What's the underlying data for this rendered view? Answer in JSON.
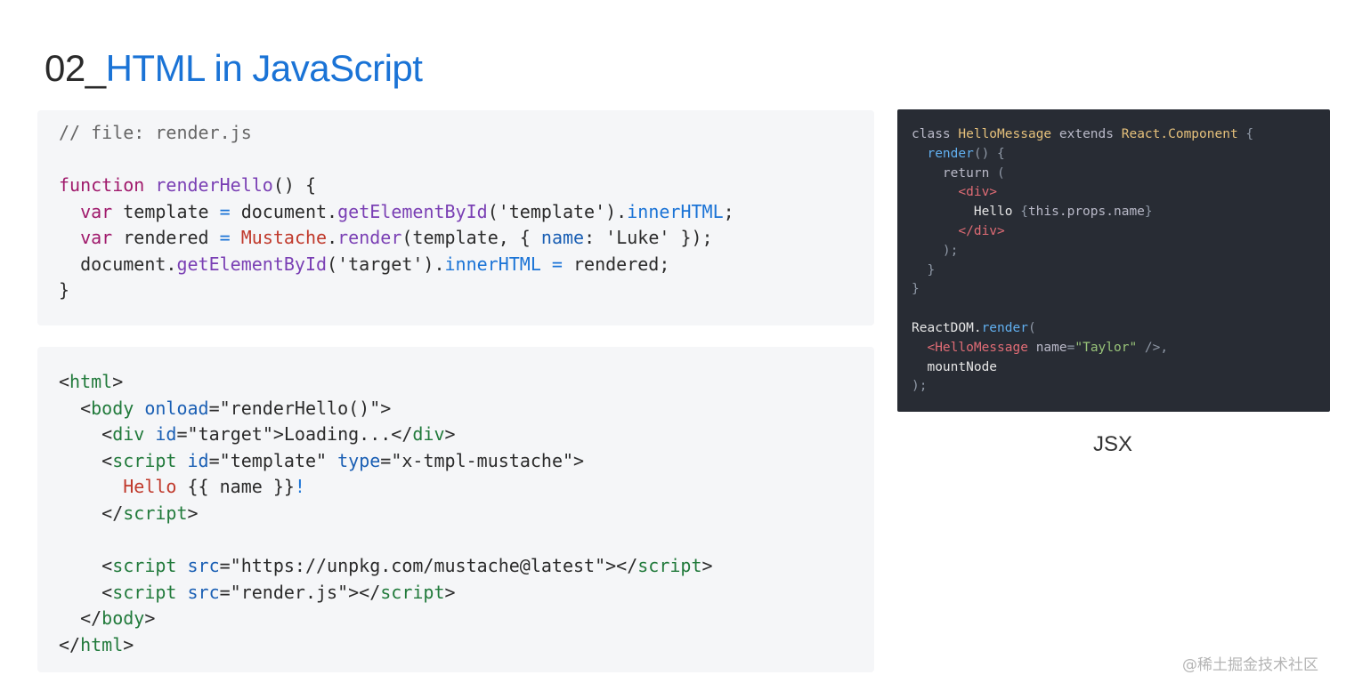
{
  "title": {
    "number": "02_",
    "text": "HTML in JavaScript"
  },
  "colors": {
    "title_accent": "#1a73d6",
    "code_keyword": "#a01a6c",
    "code_function": "#7a3fb4",
    "code_var": "#a01a6c",
    "code_method": "#1a73d6",
    "code_class": "#c0392b",
    "code_string": "#2b2b2b",
    "code_prop": "#1a5fb4",
    "code_comment": "#666666",
    "code_tag": "#217a3b",
    "code_attr": "#1a5fb4",
    "dark_bg": "#282c34",
    "dark_default": "#e6e6e6",
    "dark_keyword": "#b9b9c8",
    "dark_class": "#e5c07b",
    "dark_func": "#61afef",
    "dark_tag": "#e06c75",
    "dark_string": "#98c379",
    "dark_punct": "#8f98a6",
    "dark_attr": "#b9b9c8"
  },
  "code_js": [
    [
      {
        "t": "// file: render.js",
        "c": "code_comment"
      }
    ],
    [],
    [
      {
        "t": "function",
        "c": "code_keyword"
      },
      {
        "t": " "
      },
      {
        "t": "renderHello",
        "c": "code_function"
      },
      {
        "t": "() {"
      }
    ],
    [
      {
        "t": "  "
      },
      {
        "t": "var",
        "c": "code_var"
      },
      {
        "t": " template "
      },
      {
        "t": "=",
        "c": "code_method"
      },
      {
        "t": " document."
      },
      {
        "t": "getElementById",
        "c": "code_function"
      },
      {
        "t": "('template')."
      },
      {
        "t": "innerHTML",
        "c": "code_method"
      },
      {
        "t": ";"
      }
    ],
    [
      {
        "t": "  "
      },
      {
        "t": "var",
        "c": "code_var"
      },
      {
        "t": " rendered "
      },
      {
        "t": "=",
        "c": "code_method"
      },
      {
        "t": " "
      },
      {
        "t": "Mustache",
        "c": "code_class"
      },
      {
        "t": "."
      },
      {
        "t": "render",
        "c": "code_function"
      },
      {
        "t": "(template, { "
      },
      {
        "t": "name",
        "c": "code_prop"
      },
      {
        "t": ": 'Luke' });"
      }
    ],
    [
      {
        "t": "  document."
      },
      {
        "t": "getElementById",
        "c": "code_function"
      },
      {
        "t": "('target')."
      },
      {
        "t": "innerHTML",
        "c": "code_method"
      },
      {
        "t": " "
      },
      {
        "t": "=",
        "c": "code_method"
      },
      {
        "t": " rendered;"
      }
    ],
    [
      {
        "t": "}"
      }
    ]
  ],
  "code_html": [
    [
      {
        "t": "<"
      },
      {
        "t": "html",
        "c": "code_tag"
      },
      {
        "t": ">"
      }
    ],
    [
      {
        "t": "  <"
      },
      {
        "t": "body",
        "c": "code_tag"
      },
      {
        "t": " "
      },
      {
        "t": "onload",
        "c": "code_attr"
      },
      {
        "t": "=\"renderHello()\">"
      }
    ],
    [
      {
        "t": "    <"
      },
      {
        "t": "div",
        "c": "code_tag"
      },
      {
        "t": " "
      },
      {
        "t": "id",
        "c": "code_attr"
      },
      {
        "t": "=\"target\">Loading...</"
      },
      {
        "t": "div",
        "c": "code_tag"
      },
      {
        "t": ">"
      }
    ],
    [
      {
        "t": "    <"
      },
      {
        "t": "script",
        "c": "code_tag"
      },
      {
        "t": " "
      },
      {
        "t": "id",
        "c": "code_attr"
      },
      {
        "t": "=\"template\" "
      },
      {
        "t": "type",
        "c": "code_attr"
      },
      {
        "t": "=\"x-tmpl-mustache\">"
      }
    ],
    [
      {
        "t": "      "
      },
      {
        "t": "Hello",
        "c": "code_class"
      },
      {
        "t": " {{ name }}"
      },
      {
        "t": "!",
        "c": "code_method"
      }
    ],
    [
      {
        "t": "    </"
      },
      {
        "t": "script",
        "c": "code_tag"
      },
      {
        "t": ">"
      }
    ],
    [],
    [
      {
        "t": "    <"
      },
      {
        "t": "script",
        "c": "code_tag"
      },
      {
        "t": " "
      },
      {
        "t": "src",
        "c": "code_attr"
      },
      {
        "t": "=\"https://unpkg.com/mustache@latest\"></"
      },
      {
        "t": "script",
        "c": "code_tag"
      },
      {
        "t": ">"
      }
    ],
    [
      {
        "t": "    <"
      },
      {
        "t": "script",
        "c": "code_tag"
      },
      {
        "t": " "
      },
      {
        "t": "src",
        "c": "code_attr"
      },
      {
        "t": "=\"render.js\"></"
      },
      {
        "t": "script",
        "c": "code_tag"
      },
      {
        "t": ">"
      }
    ],
    [
      {
        "t": "  </"
      },
      {
        "t": "body",
        "c": "code_tag"
      },
      {
        "t": ">"
      }
    ],
    [
      {
        "t": "</"
      },
      {
        "t": "html",
        "c": "code_tag"
      },
      {
        "t": ">"
      }
    ]
  ],
  "code_jsx": [
    [
      {
        "t": "class ",
        "c": "dark_keyword"
      },
      {
        "t": "HelloMessage",
        "c": "dark_class"
      },
      {
        "t": " extends ",
        "c": "dark_keyword"
      },
      {
        "t": "React.Component",
        "c": "dark_class"
      },
      {
        "t": " {",
        "c": "dark_punct"
      }
    ],
    [
      {
        "t": "  "
      },
      {
        "t": "render",
        "c": "dark_func"
      },
      {
        "t": "() {",
        "c": "dark_punct"
      }
    ],
    [
      {
        "t": "    "
      },
      {
        "t": "return",
        "c": "dark_keyword"
      },
      {
        "t": " (",
        "c": "dark_punct"
      }
    ],
    [
      {
        "t": "      "
      },
      {
        "t": "<div>",
        "c": "dark_tag"
      }
    ],
    [
      {
        "t": "        Hello "
      },
      {
        "t": "{",
        "c": "dark_punct"
      },
      {
        "t": "this.props.name",
        "c": "dark_keyword"
      },
      {
        "t": "}",
        "c": "dark_punct"
      }
    ],
    [
      {
        "t": "      "
      },
      {
        "t": "</div>",
        "c": "dark_tag"
      }
    ],
    [
      {
        "t": "    );",
        "c": "dark_punct"
      }
    ],
    [
      {
        "t": "  }",
        "c": "dark_punct"
      }
    ],
    [
      {
        "t": "}",
        "c": "dark_punct"
      }
    ],
    [],
    [
      {
        "t": "ReactDOM."
      },
      {
        "t": "render",
        "c": "dark_func"
      },
      {
        "t": "(",
        "c": "dark_punct"
      }
    ],
    [
      {
        "t": "  "
      },
      {
        "t": "<HelloMessage",
        "c": "dark_tag"
      },
      {
        "t": " "
      },
      {
        "t": "name",
        "c": "dark_attr"
      },
      {
        "t": "=",
        "c": "dark_punct"
      },
      {
        "t": "\"Taylor\"",
        "c": "dark_string"
      },
      {
        "t": " />,",
        "c": "dark_punct"
      }
    ],
    [
      {
        "t": "  mountNode"
      }
    ],
    [
      {
        "t": ");",
        "c": "dark_punct"
      }
    ]
  ],
  "caption": "JSX",
  "watermark": "@稀土掘金技术社区"
}
